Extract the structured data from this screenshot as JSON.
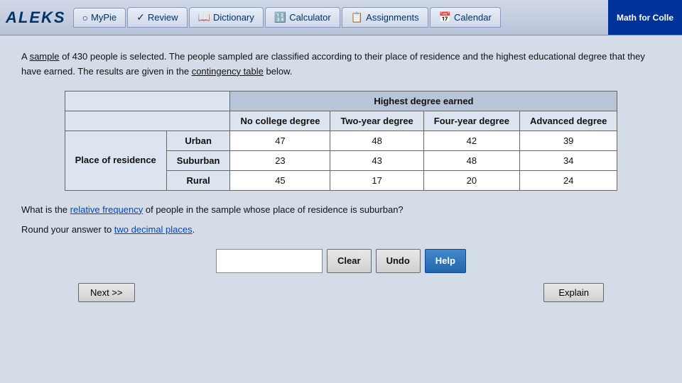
{
  "header": {
    "logo": "ALEKS",
    "math_for_college": "Math for Colle",
    "nav": [
      {
        "label": "MyPie",
        "icon": "○"
      },
      {
        "label": "Review",
        "icon": "✓"
      },
      {
        "label": "Dictionary",
        "icon": "📖"
      },
      {
        "label": "Calculator",
        "icon": "🔢"
      },
      {
        "label": "Assignments",
        "icon": "📋"
      },
      {
        "label": "Calendar",
        "icon": "📅"
      }
    ]
  },
  "problem": {
    "intro": "A sample of 430 people is selected. The people sampled are classified according to their place of residence and the highest educational degree that they have earned. The results are given in the contingency table below.",
    "underline_words": [
      "sample",
      "contingency table"
    ],
    "table": {
      "header_main": "Highest degree earned",
      "col_headers": [
        "No college degree",
        "Two-year degree",
        "Four-year degree",
        "Advanced degree"
      ],
      "row_label_group": "Place of residence",
      "rows": [
        {
          "label": "Urban",
          "values": [
            47,
            48,
            42,
            39
          ]
        },
        {
          "label": "Suburban",
          "values": [
            23,
            43,
            48,
            34
          ]
        },
        {
          "label": "Rural",
          "values": [
            45,
            17,
            20,
            24
          ]
        }
      ]
    },
    "question": "What is the relative frequency of people in the sample whose place of residence is suburban?",
    "question_underline": "relative frequency",
    "round_text": "Round your answer to two decimal places.",
    "round_underline": "two decimal places",
    "buttons": {
      "clear": "Clear",
      "undo": "Undo",
      "help": "Help",
      "next": "Next >>",
      "explain": "Explain"
    }
  }
}
